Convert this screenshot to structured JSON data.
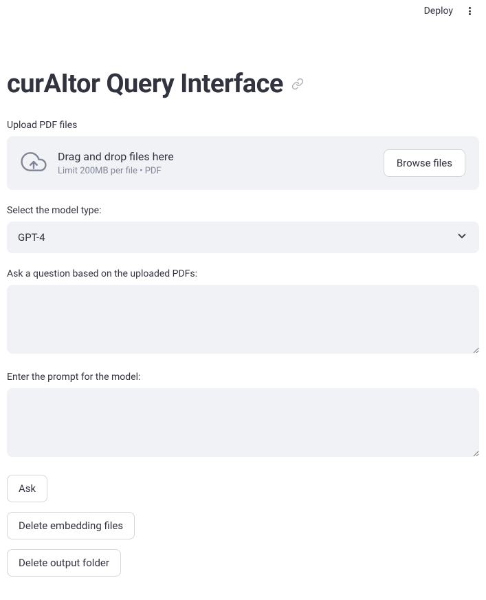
{
  "topbar": {
    "deploy_label": "Deploy"
  },
  "title": "curAItor Query Interface",
  "upload": {
    "label": "Upload PDF files",
    "main_text": "Drag and drop files here",
    "sub_text": "Limit 200MB per file • PDF",
    "browse_label": "Browse files"
  },
  "model_select": {
    "label": "Select the model type:",
    "selected": "GPT-4"
  },
  "question": {
    "label": "Ask a question based on the uploaded PDFs:",
    "value": ""
  },
  "prompt": {
    "label": "Enter the prompt for the model:",
    "value": ""
  },
  "buttons": {
    "ask": "Ask",
    "delete_embedding": "Delete embedding files",
    "delete_output": "Delete output folder"
  }
}
